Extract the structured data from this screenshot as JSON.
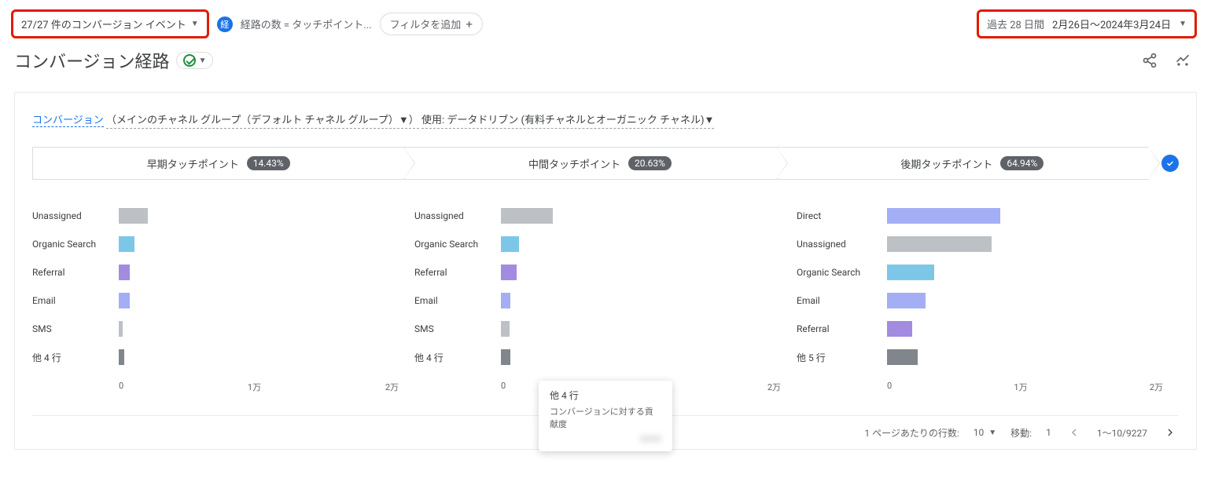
{
  "header": {
    "events_filter": "27/27 件のコンバージョン イベント",
    "path_badge": "経",
    "path_filter_text": "経路の数 = タッチポイント...",
    "add_filter": "フィルタを追加",
    "date_prefix": "過去 28 日間",
    "date_range": "2月26日～2024年3月24日"
  },
  "title": "コンバージョン経路",
  "control": {
    "metric": "コンバージョン",
    "dimension": "（メインのチャネル グループ（デフォルト チャネル グループ）▼）",
    "suffix": "使用: データドリブン (有料チャネルとオーガニック チャネル)▼"
  },
  "steps": [
    {
      "label": "早期タッチポイント",
      "pct": "14.43%"
    },
    {
      "label": "中間タッチポイント",
      "pct": "20.63%"
    },
    {
      "label": "後期タッチポイント",
      "pct": "64.94%"
    }
  ],
  "axis_ticks": [
    "0",
    "1万",
    "2万"
  ],
  "tooltip": {
    "title": "他 4 行",
    "sub": "コンバージョンに対する貢献度",
    "value": "xxxxx"
  },
  "pager": {
    "rows_label": "1 ページあたりの行数:",
    "rows_value": "10",
    "goto_label": "移動:",
    "goto_value": "1",
    "range": "1～10/9227"
  },
  "chart_data": [
    {
      "type": "bar",
      "title": "早期タッチポイント",
      "xlabel": "",
      "ylabel": "",
      "xlim": [
        0,
        20000
      ],
      "categories": [
        "Unassigned",
        "Organic Search",
        "Referral",
        "Email",
        "SMS",
        "他 4 行"
      ],
      "values": [
        2100,
        1100,
        800,
        800,
        300,
        400
      ],
      "colors": [
        "#bdc1c6",
        "#7cc7e8",
        "#a28ce0",
        "#a4aef5",
        "#bdc1c6",
        "#80868b"
      ]
    },
    {
      "type": "bar",
      "title": "中間タッチポイント",
      "xlabel": "",
      "ylabel": "",
      "xlim": [
        0,
        20000
      ],
      "categories": [
        "Unassigned",
        "Organic Search",
        "Referral",
        "Email",
        "SMS",
        "他 4 行"
      ],
      "values": [
        3700,
        1300,
        1100,
        700,
        600,
        700
      ],
      "colors": [
        "#bdc1c6",
        "#7cc7e8",
        "#a28ce0",
        "#a4aef5",
        "#bdc1c6",
        "#80868b"
      ]
    },
    {
      "type": "bar",
      "title": "後期タッチポイント",
      "xlabel": "",
      "ylabel": "",
      "xlim": [
        0,
        20000
      ],
      "categories": [
        "Direct",
        "Unassigned",
        "Organic Search",
        "Email",
        "Referral",
        "他 5 行"
      ],
      "values": [
        8200,
        7600,
        3400,
        2800,
        1800,
        2200
      ],
      "colors": [
        "#a4aef5",
        "#bdc1c6",
        "#7cc7e8",
        "#a4aef5",
        "#a28ce0",
        "#80868b"
      ]
    }
  ]
}
